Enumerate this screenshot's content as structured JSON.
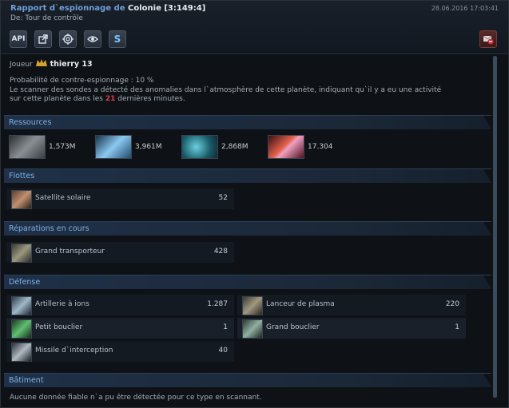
{
  "header": {
    "title_prefix": "Rapport d`espionnage de",
    "planet": "Colonie [3:149:4]",
    "date": "28.06.2016 17:03:41",
    "from": "De: Tour de contrôle"
  },
  "toolbar": {
    "api_label": "API",
    "share_icon": "share-icon",
    "target_icon": "target-icon",
    "eye_icon": "eye-icon",
    "s_label": "S",
    "delete_icon": "delete-message-icon"
  },
  "player": {
    "label": "Joueur",
    "name": "thierry 13"
  },
  "info": {
    "counter_espionage": "Probabilité de contre-espionnage : 10 %",
    "anomaly_text": "Le scanner des sondes a détecté des anomalies dans l`atmosphère de cette planète, indiquant qu`il y a eu une activité",
    "anomaly_text2_pre": "sur cette planète dans les",
    "minutes": "21",
    "anomaly_text2_post": "dernières minutes."
  },
  "sections": {
    "resources": "Ressources",
    "fleets": "Flottes",
    "repairs": "Réparations en cours",
    "defense": "Défense",
    "buildings": "Bâtiment"
  },
  "resources": [
    {
      "icon": "metal-icon",
      "value": "1,573M",
      "color": "#8a8f94"
    },
    {
      "icon": "crystal-icon",
      "value": "3,961M",
      "color": "#8cc8f0"
    },
    {
      "icon": "deuterium-icon",
      "value": "2,868M",
      "color": "#3aa8b8"
    },
    {
      "icon": "energy-icon",
      "value": "17.304",
      "color": "#e0604a"
    }
  ],
  "fleets": [
    {
      "name": "Satellite solaire",
      "count": "52"
    }
  ],
  "repairs": [
    {
      "name": "Grand transporteur",
      "count": "428"
    }
  ],
  "defense_left": [
    {
      "name": "Artillerie à ions",
      "count": "1.287"
    },
    {
      "name": "Petit bouclier",
      "count": "1"
    },
    {
      "name": "Missile d`interception",
      "count": "40"
    }
  ],
  "defense_right": [
    {
      "name": "Lanceur de plasma",
      "count": "220"
    },
    {
      "name": "Grand bouclier",
      "count": "1"
    }
  ],
  "buildings_text": "Aucune donnée fiable n`a pu être détectée pour ce type en scannant."
}
